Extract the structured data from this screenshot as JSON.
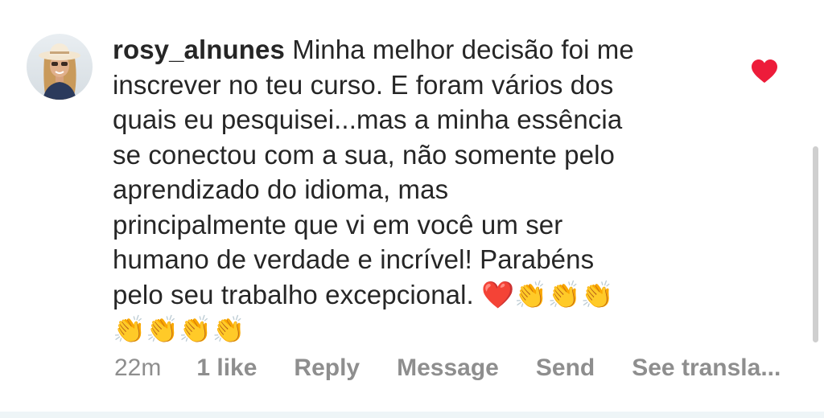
{
  "comment": {
    "username": "rosy_alnunes",
    "text_lines": [
      "Minha melhor decisão foi me",
      "inscrever no teu curso. E foram vários dos",
      "quais eu pesquisei...mas a minha essência",
      "se conectou com a sua, não somente pelo",
      "aprendizado do idioma, mas",
      "principalmente que vi em você um ser",
      "humano de verdade e incrível! Parabéns",
      "pelo seu trabalho excepcional."
    ],
    "emoji_line_1": "❤️👏👏👏",
    "emoji_line_2": "👏👏👏👏",
    "liked": true
  },
  "actions": {
    "time": "22m",
    "likes": "1 like",
    "reply": "Reply",
    "message": "Message",
    "send": "Send",
    "see_translation": "See transla..."
  },
  "colors": {
    "text": "#262626",
    "secondary": "#8e8e8e",
    "like_heart": "#ed1c3a"
  },
  "icons": {
    "like": "heart-icon",
    "avatar": "profile-photo"
  }
}
